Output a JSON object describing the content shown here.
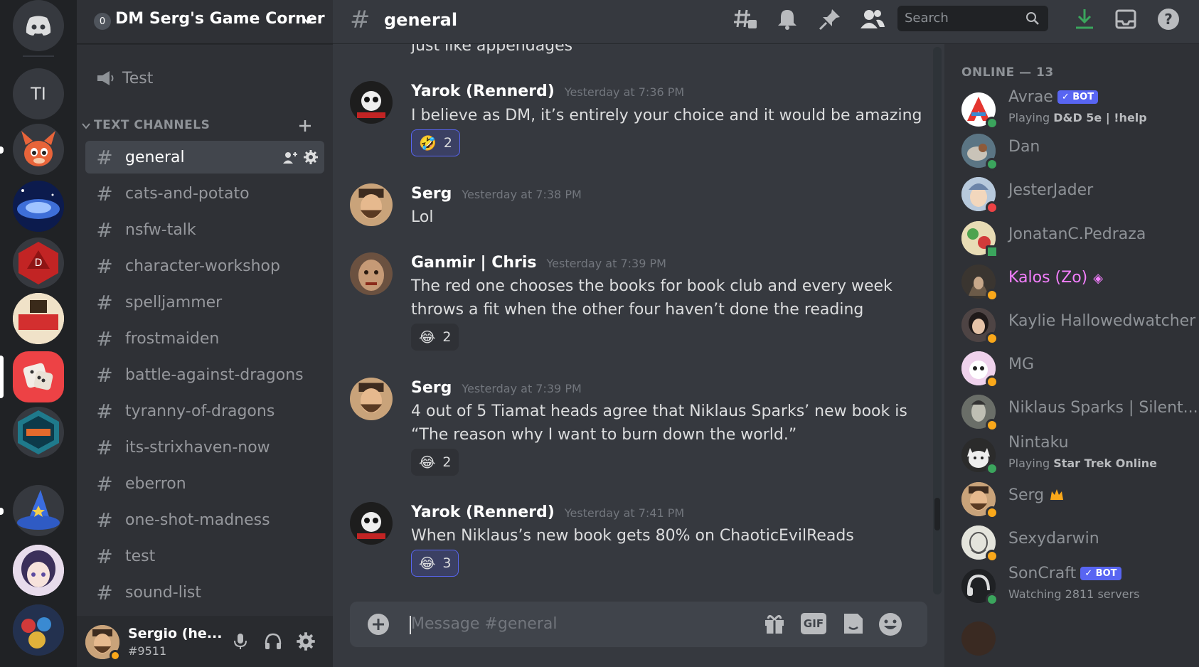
{
  "server": {
    "name": "DM Serg's Game Corner"
  },
  "rail": {
    "servers": [
      {
        "initials": "TI"
      }
    ]
  },
  "sidebar": {
    "voice": [
      {
        "name": "Test"
      }
    ],
    "category": "TEXT CHANNELS",
    "channels": [
      {
        "name": "general"
      },
      {
        "name": "cats-and-potato"
      },
      {
        "name": "nsfw-talk"
      },
      {
        "name": "character-workshop"
      },
      {
        "name": "spelljammer"
      },
      {
        "name": "frostmaiden"
      },
      {
        "name": "battle-against-dragons"
      },
      {
        "name": "tyranny-of-dragons"
      },
      {
        "name": "its-strixhaven-now"
      },
      {
        "name": "eberron"
      },
      {
        "name": "one-shot-madness"
      },
      {
        "name": "test"
      },
      {
        "name": "sound-list"
      }
    ]
  },
  "user": {
    "name": "Sergio (he...",
    "tag": "#9511"
  },
  "chat": {
    "channel": "general",
    "search_placeholder": "Search",
    "partial_line": "just like appendages",
    "messages": [
      {
        "author": "Yarok (Rennerd)",
        "time": "Yesterday at 7:36 PM",
        "lines": [
          "I believe as DM, it’s entirely your choice and it would be amazing"
        ],
        "reaction": {
          "emoji": "🤣",
          "count": "2"
        }
      },
      {
        "author": "Serg",
        "time": "Yesterday at 7:38 PM",
        "lines": [
          "Lol"
        ]
      },
      {
        "author": "Ganmir | Chris",
        "time": "Yesterday at 7:39 PM",
        "lines": [
          "The red one chooses the books for book club and every week",
          "throws a fit when the other four haven’t done the reading"
        ],
        "reaction": {
          "emoji": "😂",
          "count": "2"
        }
      },
      {
        "author": "Serg",
        "time": "Yesterday at 7:39 PM",
        "lines": [
          "4 out of 5 Tiamat heads agree that Niklaus Sparks’ new book is",
          "“The reason why I want to burn down the world.”"
        ],
        "reaction": {
          "emoji": "😂",
          "count": "2"
        }
      },
      {
        "author": "Yarok (Rennerd)",
        "time": "Yesterday at 7:41 PM",
        "lines": [
          "When Niklaus’s new book gets 80% on ChaoticEvilReads"
        ],
        "reaction": {
          "emoji": "😂",
          "count": "3"
        }
      }
    ],
    "composer_placeholder": "Message #general",
    "gif_label": "GIF"
  },
  "members": {
    "heading": "ONLINE — 13",
    "bot_label": "BOT",
    "list": [
      {
        "name": "Avrae",
        "bot": true,
        "activity_prefix": "Playing ",
        "activity": "D&D 5e | !help",
        "status": "#3ba55d",
        "color": "#8e9297"
      },
      {
        "name": "Dan",
        "status": "#3ba55d",
        "color": "#8e9297"
      },
      {
        "name": "JesterJader",
        "status": "#ed4245",
        "color": "#8e9297"
      },
      {
        "name": "JonatanC.Pedraza",
        "status": "#3ba55d",
        "color": "#8e9297"
      },
      {
        "name": "Kalos (Zo)",
        "status": "#faa81a",
        "color": "#f47fff"
      },
      {
        "name": "Kaylie Hallowedwatcher",
        "status": "#faa81a",
        "color": "#8e9297"
      },
      {
        "name": "MG",
        "status": "#faa81a",
        "color": "#8e9297"
      },
      {
        "name": "Niklaus Sparks | Silent...",
        "status": "#faa81a",
        "color": "#8e9297"
      },
      {
        "name": "Nintaku",
        "activity_prefix": "Playing ",
        "activity": "Star Trek Online",
        "status": "#3ba55d",
        "color": "#8e9297"
      },
      {
        "name": "Serg",
        "status": "#faa81a",
        "color": "#8e9297"
      },
      {
        "name": "Sexydarwin",
        "status": "#faa81a",
        "color": "#8e9297"
      },
      {
        "name": "SonCraft",
        "bot": true,
        "activity_prefix": "Watching ",
        "activity": "2811 servers",
        "status": "#3ba55d",
        "color": "#8e9297"
      }
    ]
  }
}
